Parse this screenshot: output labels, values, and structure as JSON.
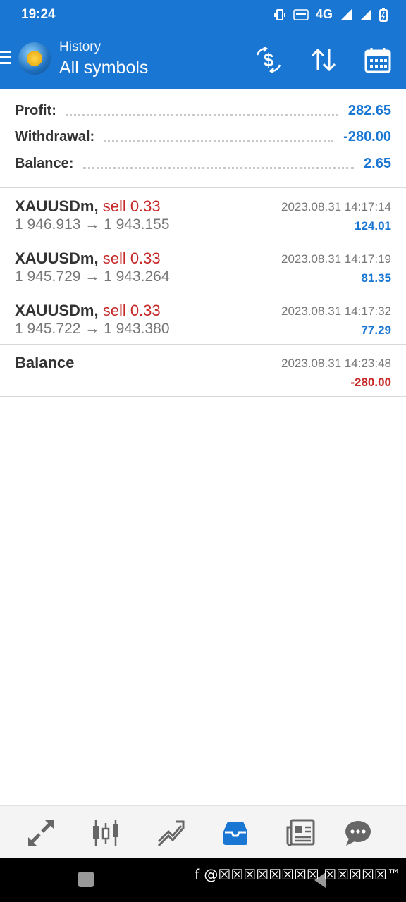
{
  "status": {
    "time": "19:24",
    "network": "4G"
  },
  "header": {
    "subtitle": "History",
    "title": "All symbols"
  },
  "summary": [
    {
      "label": "Profit:",
      "value": "282.65"
    },
    {
      "label": "Withdrawal:",
      "value": "-280.00"
    },
    {
      "label": "Balance:",
      "value": "2.65"
    }
  ],
  "deals": [
    {
      "symbol": "XAUUSDm,",
      "action": "sell 0.33",
      "prices": "1 946.913 → 1 943.155",
      "time": "2023.08.31 14:17:14",
      "profit": "124.01"
    },
    {
      "symbol": "XAUUSDm,",
      "action": "sell 0.33",
      "prices": "1 945.729 → 1 943.264",
      "time": "2023.08.31 14:17:19",
      "profit": "81.35"
    },
    {
      "symbol": "XAUUSDm,",
      "action": "sell 0.33",
      "prices": "1 945.722 → 1 943.380",
      "time": "2023.08.31 14:17:32",
      "profit": "77.29"
    },
    {
      "symbol": "Balance",
      "action": "",
      "prices": "",
      "time": "2023.08.31 14:23:48",
      "profit": "-280.00"
    }
  ],
  "watermark": "f @☒☒☒☒☒☒☒☒ ☒☒☒☒☒™",
  "colors": {
    "primary": "#1976d2",
    "sell": "#c62828",
    "negative": "#c62828"
  },
  "icons": {
    "toolbar": [
      "money-exchange-icon",
      "sort-icon",
      "calendar-icon"
    ],
    "nav": [
      "quotes-icon",
      "chart-icon",
      "trade-icon",
      "history-icon",
      "news-icon",
      "chat-icon"
    ]
  }
}
